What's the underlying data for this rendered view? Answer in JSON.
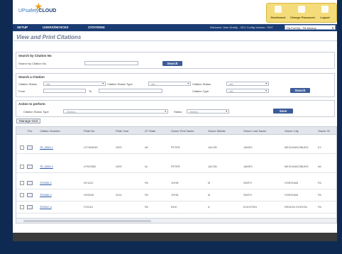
{
  "app": {
    "logo_prefix": "UPs",
    "logo_brand": "CLOUD",
    "logo_mid": "afety"
  },
  "top_actions": [
    {
      "label": "Dashboard",
      "icon": "home-icon"
    },
    {
      "label": "Change Password",
      "icon": "key-icon"
    },
    {
      "label": "Logout",
      "icon": "power-icon"
    }
  ],
  "nav": {
    "items": [
      "SETUP",
      "USERS/DEVICES",
      "CITATIONS"
    ],
    "welcome": "Welcome John Dredly - 25.2 Config Version: 7537",
    "context": "PA-ForCity - PA Moving"
  },
  "page_title": "View and Print Citations",
  "search_no": {
    "title": "Search by Citation No",
    "label": "Search by Citation No.",
    "value": "",
    "button": "Search"
  },
  "search_citation": {
    "title": "Search a Citation",
    "status_label": "Citation Status",
    "status_value": "-All-",
    "type_label": "Citation Status Type",
    "type_value": "-All-",
    "status2_label": "Citation Status",
    "status2_value": "-All-",
    "from_label": "From",
    "to_label": "To",
    "ctype_label": "Citation Type",
    "ctype_value": "-All-",
    "button": "Search"
  },
  "action": {
    "title": "Action to perform",
    "type_label": "Citation Status Type",
    "type_value": "--Select--",
    "status_label": "Status",
    "status_value": "-Select-",
    "button": "Save"
  },
  "manage_grid": "Manage Grid",
  "table": {
    "columns": [
      "Prn.",
      "Citation Number",
      "Plate No",
      "Plate Year",
      "LP State",
      "Owner First Name",
      "Owner Middle",
      "Owner Last Name",
      "Owner City",
      "Owner St"
    ],
    "rows": [
      [
        "TE_5263-1",
        "LP7845259",
        "2003",
        "AK",
        "PETER",
        "JACOB",
        "JAMES",
        "MECHANICSBURG",
        "KY"
      ],
      [
        "TE_5263-4",
        "LP547852",
        "2009",
        "AL",
        "PETER",
        "JACOB",
        "JAMES",
        "MECHANICSBURG",
        "AK"
      ],
      [
        "TE0359-2",
        "KK1412",
        "",
        "PA",
        "JOHN",
        "M",
        "SMITH",
        "HOESHAM",
        "PA"
      ],
      [
        "TE0460-2",
        "GK5545",
        "2014",
        "PA",
        "JOHN",
        "M",
        "SMITH",
        "HOESHAM",
        "PA"
      ],
      [
        "TE0347-4",
        "PJ2410",
        "",
        "PA",
        "EKIC",
        "A",
        "ECKSTEIN",
        "REGION STATION",
        "PA"
      ]
    ]
  }
}
